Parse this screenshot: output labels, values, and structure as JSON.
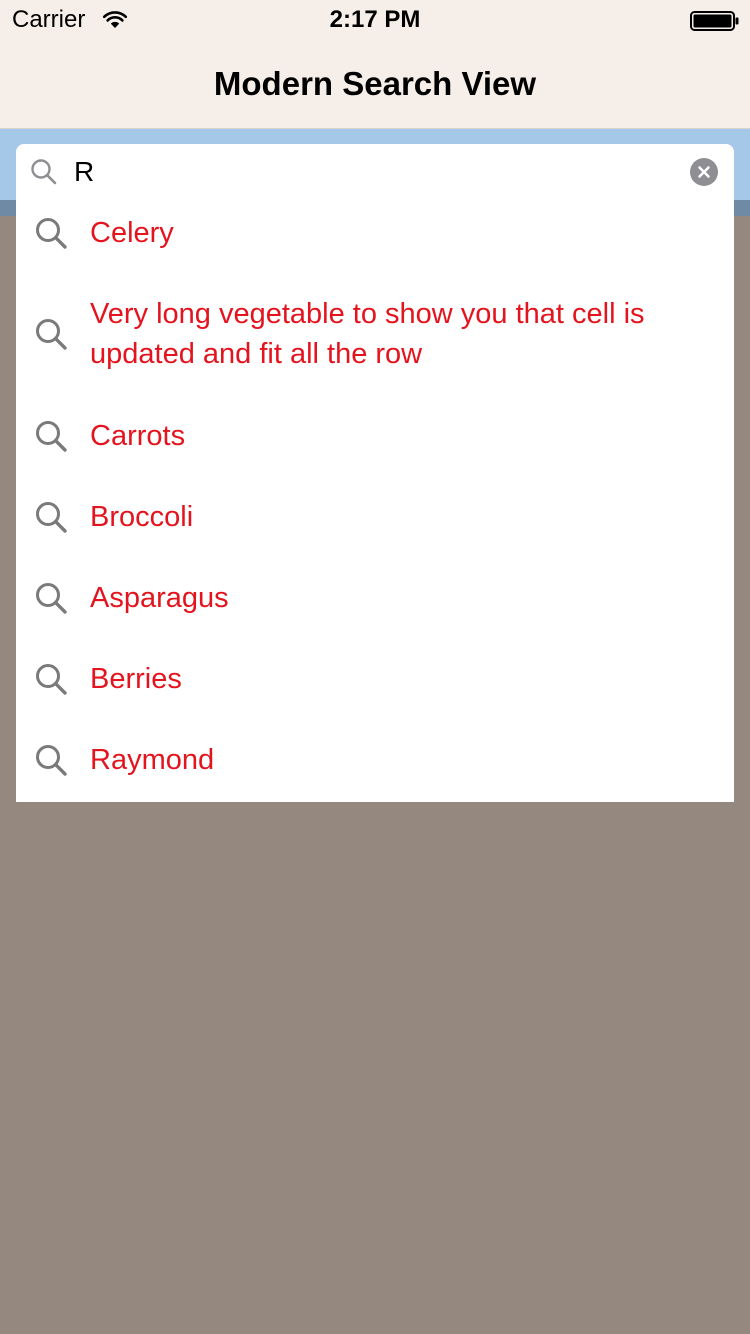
{
  "status_bar": {
    "carrier": "Carrier",
    "time": "2:17 PM",
    "wifi_icon": "wifi-icon",
    "battery_icon": "battery-full-icon"
  },
  "nav": {
    "title": "Modern Search View"
  },
  "search": {
    "value": "R",
    "search_icon": "search-icon",
    "clear_icon": "clear-x-icon"
  },
  "results": [
    {
      "label": "Celery"
    },
    {
      "label": "Very long vegetable to show you that cell is updated and fit all the row"
    },
    {
      "label": "Carrots"
    },
    {
      "label": "Broccoli"
    },
    {
      "label": "Asparagus"
    },
    {
      "label": "Berries"
    },
    {
      "label": "Raymond"
    }
  ],
  "colors": {
    "nav_background": "#f6efe9",
    "search_band": "#a5c8e8",
    "page_background": "#94887f",
    "result_text": "#e4141e"
  }
}
